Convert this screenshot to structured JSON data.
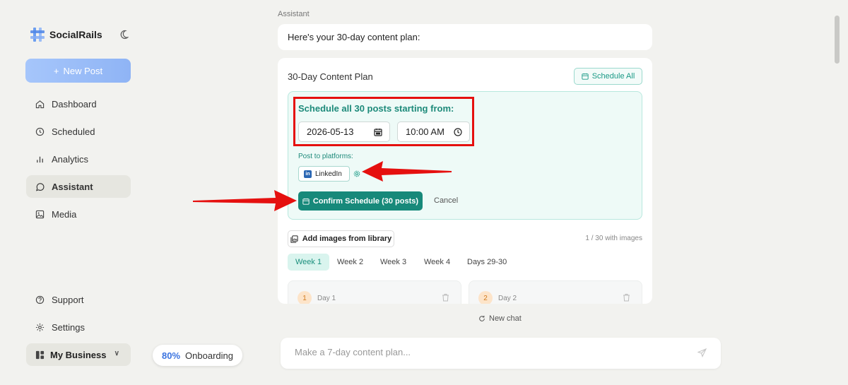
{
  "sidebar": {
    "brand": "SocialRails",
    "new_post_label": "New Post",
    "nav": [
      {
        "label": "Dashboard",
        "icon": "home-icon"
      },
      {
        "label": "Scheduled",
        "icon": "clock-icon"
      },
      {
        "label": "Analytics",
        "icon": "bar-chart-icon"
      },
      {
        "label": "Assistant",
        "icon": "chat-bubble-icon",
        "active": true
      },
      {
        "label": "Media",
        "icon": "image-icon"
      }
    ],
    "footer_nav": [
      {
        "label": "Support",
        "icon": "help-circle-icon"
      },
      {
        "label": "Settings",
        "icon": "gear-icon"
      }
    ],
    "business": "My Business"
  },
  "onboarding": {
    "percent": "80%",
    "label": "Onboarding"
  },
  "chat": {
    "assistant_label": "Assistant",
    "message": "Here's your 30-day content plan:",
    "new_chat_label": "New chat",
    "input_placeholder": "Make a 7-day content plan..."
  },
  "plan": {
    "title": "30-Day Content Plan",
    "schedule_all_label": "Schedule All",
    "schedule_panel": {
      "title": "Schedule all 30 posts starting from:",
      "date_value": "2026-05-13",
      "time_value": "10:00 AM",
      "platforms_label": "Post to platforms:",
      "platform": "LinkedIn",
      "confirm_label": "Confirm Schedule (30 posts)",
      "cancel_label": "Cancel"
    },
    "add_images_label": "Add images from library",
    "images_count": "1 / 30 with images",
    "tabs": [
      "Week 1",
      "Week 2",
      "Week 3",
      "Week 4",
      "Days 29-30"
    ],
    "days": [
      {
        "num": "1",
        "label": "Day 1"
      },
      {
        "num": "2",
        "label": "Day 2"
      }
    ]
  },
  "colors": {
    "accent": "#17897a",
    "brand_blue": "#8fb4f5",
    "annotation_red": "#e5100f"
  }
}
